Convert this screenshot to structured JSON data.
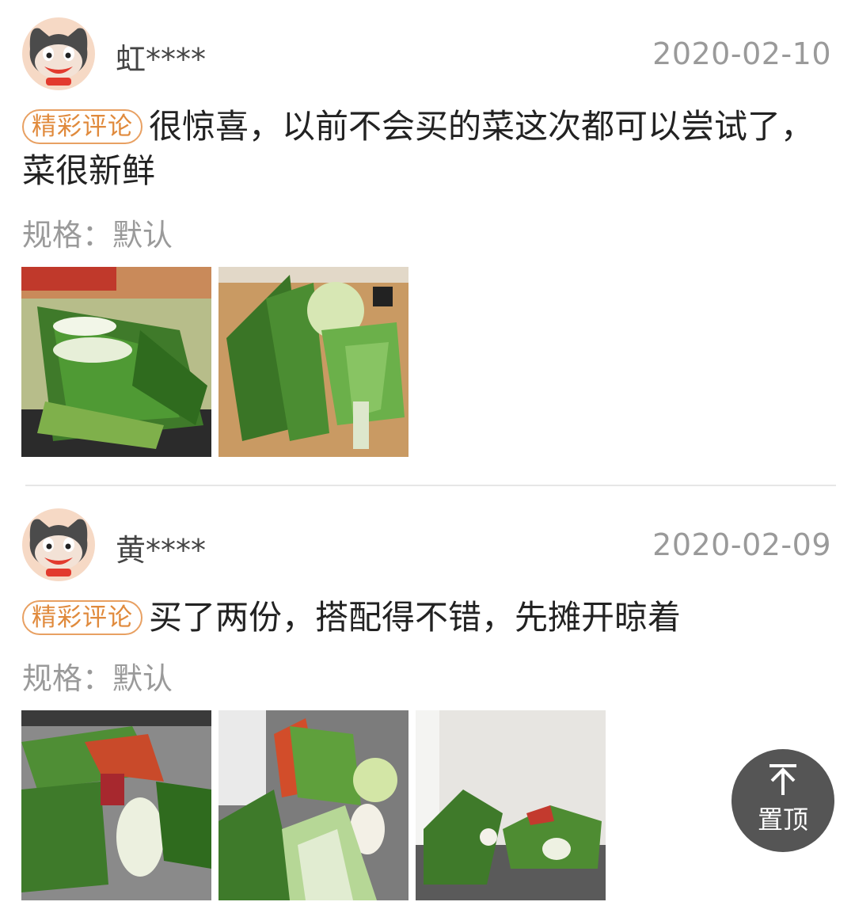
{
  "reviews": [
    {
      "username": "虹****",
      "date": "2020-02-10",
      "badge": "精彩评论",
      "comment": "很惊喜，以前不会买的菜这次都可以尝试了，菜很新鲜",
      "spec": "规格：默认",
      "photo_count": 2
    },
    {
      "username": "黄****",
      "date": "2020-02-09",
      "badge": "精彩评论",
      "comment": "买了两份，搭配得不错，先摊开晾着",
      "spec": "规格：默认",
      "photo_count": 3
    }
  ],
  "top_button": {
    "label": "置顶",
    "icon": "arrow-to-top-icon"
  },
  "colors": {
    "badge": "#e08a3c",
    "meta": "#9a9a9a",
    "top_button_bg": "#555555"
  }
}
